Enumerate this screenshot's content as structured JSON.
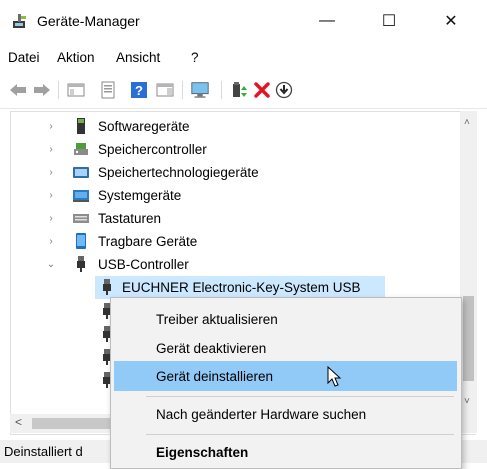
{
  "window": {
    "title": "Geräte-Manager",
    "minimize": "—",
    "maximize": "☐",
    "close": "✕"
  },
  "menubar": [
    "Datei",
    "Aktion",
    "Ansicht",
    "?"
  ],
  "toolbar": [
    "back-arrow-icon",
    "forward-arrow-icon",
    "show-hide-console-tree-icon",
    "properties-icon",
    "help-icon",
    "action-pane-icon",
    "scan-hardware-icon",
    "update-driver-icon",
    "uninstall-device-icon",
    "disable-device-icon"
  ],
  "tree": {
    "items": [
      {
        "label": "Softwaregeräte",
        "expander": "›"
      },
      {
        "label": "Speichercontroller",
        "expander": "›"
      },
      {
        "label": "Speichertechnologiegeräte",
        "expander": "›"
      },
      {
        "label": "Systemgeräte",
        "expander": "›"
      },
      {
        "label": "Tastaturen",
        "expander": "›"
      },
      {
        "label": "Tragbare Geräte",
        "expander": "›"
      },
      {
        "label": "USB-Controller",
        "expander": "⌄"
      }
    ],
    "selected_child": "EUCHNER Electronic-Key-System USB"
  },
  "context_menu": {
    "items": [
      "Treiber aktualisieren",
      "Gerät deaktivieren",
      "Gerät deinstallieren",
      "Nach geänderter Hardware suchen",
      "Eigenschaften"
    ],
    "highlighted": "Gerät deinstallieren"
  },
  "scroll": {
    "up": "˄",
    "down": "˅",
    "left": "<"
  },
  "status": "Deinstalliert d",
  "colors": {
    "selection": "#cce8ff",
    "menu_highlight": "#91c9f7",
    "delete_red": "#e81123"
  }
}
